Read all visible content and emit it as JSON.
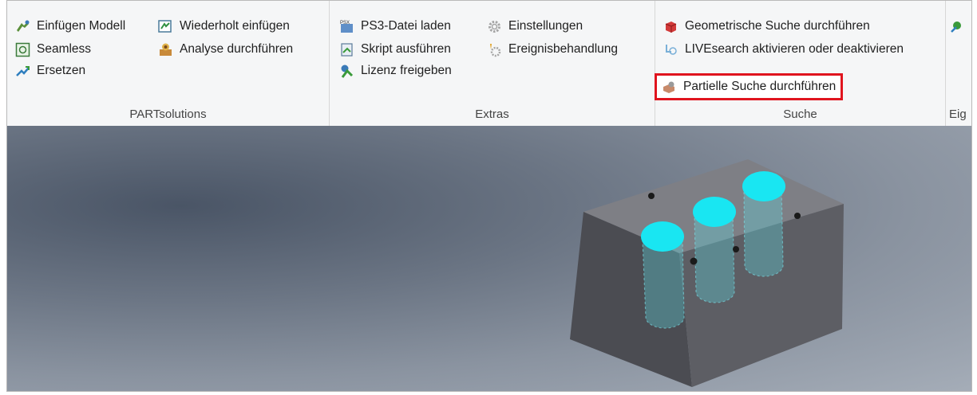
{
  "ribbon": {
    "groups": [
      {
        "label": "PARTsolutions",
        "buttons": [
          {
            "label": "Einfügen Modell",
            "icon": "insert-model-icon"
          },
          {
            "label": "Wiederholt einfügen",
            "icon": "repeat-insert-icon"
          },
          {
            "label": "Seamless",
            "icon": "seamless-icon"
          },
          {
            "label": "Analyse durchführen",
            "icon": "analysis-icon"
          },
          {
            "label": "Ersetzen",
            "icon": "replace-icon"
          }
        ]
      },
      {
        "label": "Extras",
        "buttons": [
          {
            "label": "PS3-Datei laden",
            "icon": "ps3-file-icon"
          },
          {
            "label": "Einstellungen",
            "icon": "gear-icon"
          },
          {
            "label": "Skript ausführen",
            "icon": "script-icon"
          },
          {
            "label": "Ereignisbehandlung",
            "icon": "event-handling-icon"
          },
          {
            "label": "Lizenz freigeben",
            "icon": "license-icon"
          }
        ]
      },
      {
        "label": "Suche",
        "buttons": [
          {
            "label": "Geometrische Suche durchführen",
            "icon": "geometric-search-icon"
          },
          {
            "label": "LIVEsearch aktivieren oder deaktivieren",
            "icon": "livesearch-icon"
          },
          {
            "label": "Partielle Suche durchführen",
            "icon": "partial-search-icon",
            "highlighted": true
          }
        ]
      },
      {
        "label": "Eig",
        "buttons": [
          {
            "label": "",
            "icon": "properties-icon"
          }
        ]
      }
    ]
  },
  "colors": {
    "highlight": "#e0141e",
    "hole_cyan": "#19e6f2",
    "block_gray": "#58595e"
  }
}
